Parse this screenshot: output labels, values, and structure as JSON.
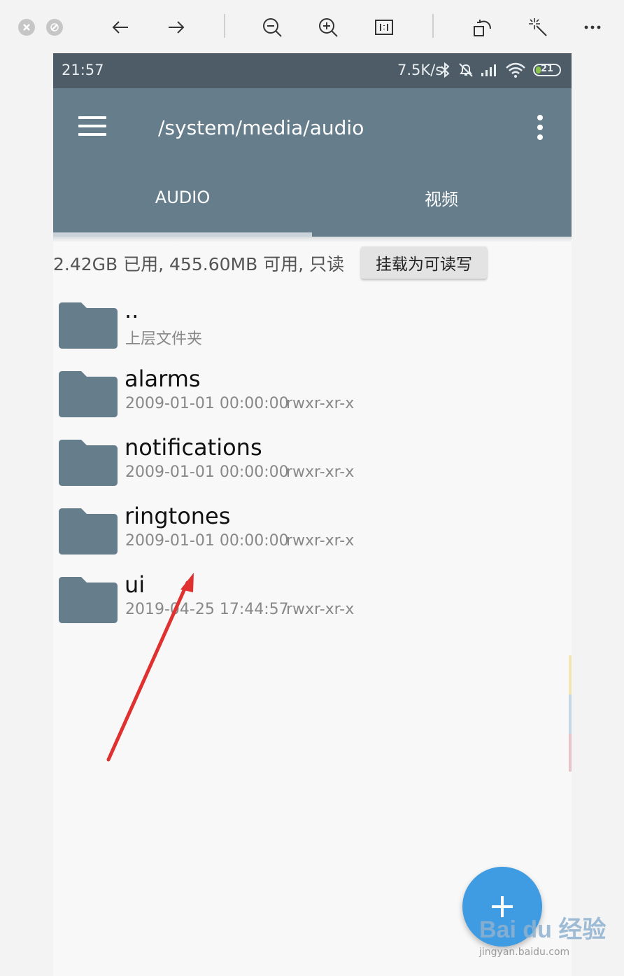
{
  "viewer": {
    "tools": [
      "close-icon",
      "minimize-icon",
      "back-arrow-icon",
      "forward-arrow-icon",
      "zoom-out-icon",
      "zoom-in-icon",
      "actual-size-icon",
      "rotate-icon",
      "magic-wand-icon",
      "more-icon"
    ]
  },
  "status_bar": {
    "time": "21:57",
    "net_speed": "7.5K/s",
    "battery": "21",
    "battery_level_percent": 21
  },
  "app_bar": {
    "title": "/system/media/audio"
  },
  "tabs": [
    {
      "label": "AUDIO",
      "selected": true
    },
    {
      "label": "视频",
      "selected": false
    }
  ],
  "storage": {
    "info": "2.42GB 已用, 455.60MB 可用, 只读",
    "mount_button": "挂载为可读写"
  },
  "files": [
    {
      "name": "..",
      "meta": "上层文件夹",
      "perm": ""
    },
    {
      "name": "alarms",
      "meta": "2009-01-01 00:00:00",
      "perm": "rwxr-xr-x"
    },
    {
      "name": "notifications",
      "meta": "2009-01-01 00:00:00",
      "perm": "rwxr-xr-x"
    },
    {
      "name": "ringtones",
      "meta": "2009-01-01 00:00:00",
      "perm": "rwxr-xr-x"
    },
    {
      "name": "ui",
      "meta": "2019-04-25 17:44:57",
      "perm": "rwxr-xr-x"
    }
  ],
  "colors": {
    "status_bar": "#4d5c67",
    "app_bar": "#667d8b",
    "folder": "#667d8b",
    "fab": "#3f9be2",
    "annotation_arrow": "#e03131"
  },
  "watermark": {
    "logo": "Bai du 经验",
    "site": "jingyan.baidu.com"
  }
}
